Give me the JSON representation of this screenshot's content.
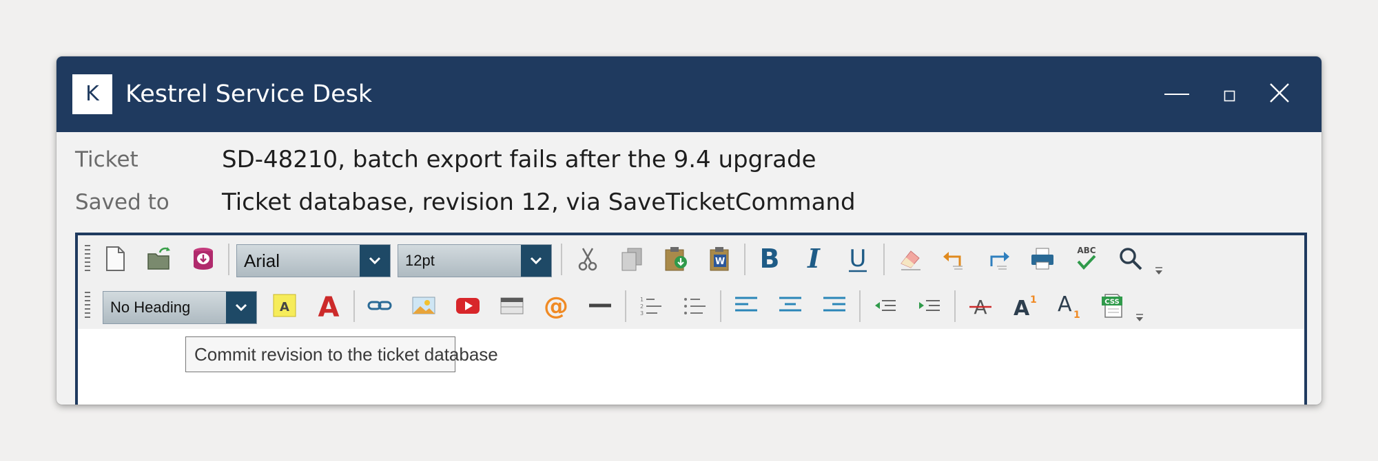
{
  "window": {
    "logo_letter": "K",
    "title": "Kestrel Service Desk",
    "brand_color": "#1f3a5f"
  },
  "ticket": {
    "ticket_label": "Ticket",
    "ticket_value": "SD-48210, batch export fails after the 9.4 upgrade",
    "saved_label": "Saved to",
    "saved_value": "Ticket database, revision 12, via SaveTicketCommand"
  },
  "toolbar": {
    "font_family": "Arial",
    "font_size": "12pt",
    "heading_style": "No Heading",
    "css_icon_label": "CSS",
    "spellcheck_icon_label": "ABC",
    "word_icon_label": "W"
  },
  "editor": {
    "tooltip": "Commit revision to the ticket database"
  }
}
